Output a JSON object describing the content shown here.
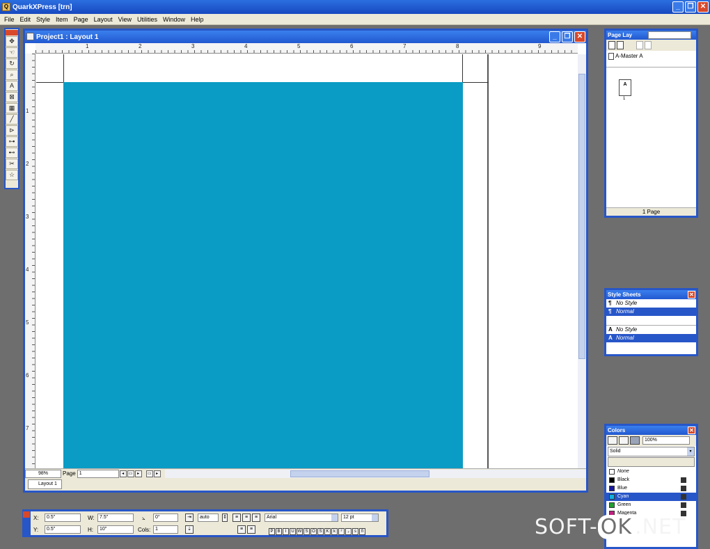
{
  "app": {
    "title": "QuarkXPress [trn]"
  },
  "menu": [
    "File",
    "Edit",
    "Style",
    "Item",
    "Page",
    "Layout",
    "View",
    "Utilities",
    "Window",
    "Help"
  ],
  "document": {
    "title": "Project1 : Layout 1",
    "ruler_h": [
      "1",
      "2",
      "3",
      "4",
      "5",
      "6",
      "7",
      "8",
      "9"
    ],
    "ruler_v": [
      "1",
      "2",
      "3",
      "4",
      "5",
      "6",
      "7"
    ],
    "zoom": "98%",
    "page_label": "Page",
    "page_value": "1",
    "layout_tab": "Layout 1",
    "box_color": "#0a9cc4"
  },
  "page_layout": {
    "title": "Page Lay",
    "master": "A-Master A",
    "thumb_letter": "A",
    "thumb_number": "1",
    "footer": "1 Page"
  },
  "style_sheets": {
    "title": "Style Sheets",
    "paragraph": [
      {
        "label": "No Style",
        "selected": false
      },
      {
        "label": "Normal",
        "selected": true
      }
    ],
    "character": [
      {
        "label": "No Style",
        "selected": false
      },
      {
        "label": "Normal",
        "selected": true
      }
    ]
  },
  "colors": {
    "title": "Colors",
    "percent": "100%",
    "fill_type": "Solid",
    "items": [
      {
        "label": "None",
        "swatch": "#ffffff",
        "selected": false
      },
      {
        "label": "Black",
        "swatch": "#000000",
        "selected": false
      },
      {
        "label": "Blue",
        "swatch": "#1a1aa0",
        "selected": false
      },
      {
        "label": "Cyan",
        "swatch": "#10b0e0",
        "selected": true
      },
      {
        "label": "Green",
        "swatch": "#20a030",
        "selected": false
      },
      {
        "label": "Magenta",
        "swatch": "#c02080",
        "selected": false
      }
    ]
  },
  "measurements": {
    "x_label": "X:",
    "x_value": "0.5\"",
    "y_label": "Y:",
    "y_value": "0.5\"",
    "w_label": "W:",
    "w_value": "7.5\"",
    "h_label": "H:",
    "h_value": "10\"",
    "angle_label": "⦣",
    "angle_value": "0°",
    "cols_label": "Cols:",
    "cols_value": "1",
    "leading": "auto",
    "font": "Arial",
    "size": "12 pt"
  },
  "watermark": {
    "left": "SOFT-",
    "ok": "OK",
    "right": ".NET"
  }
}
